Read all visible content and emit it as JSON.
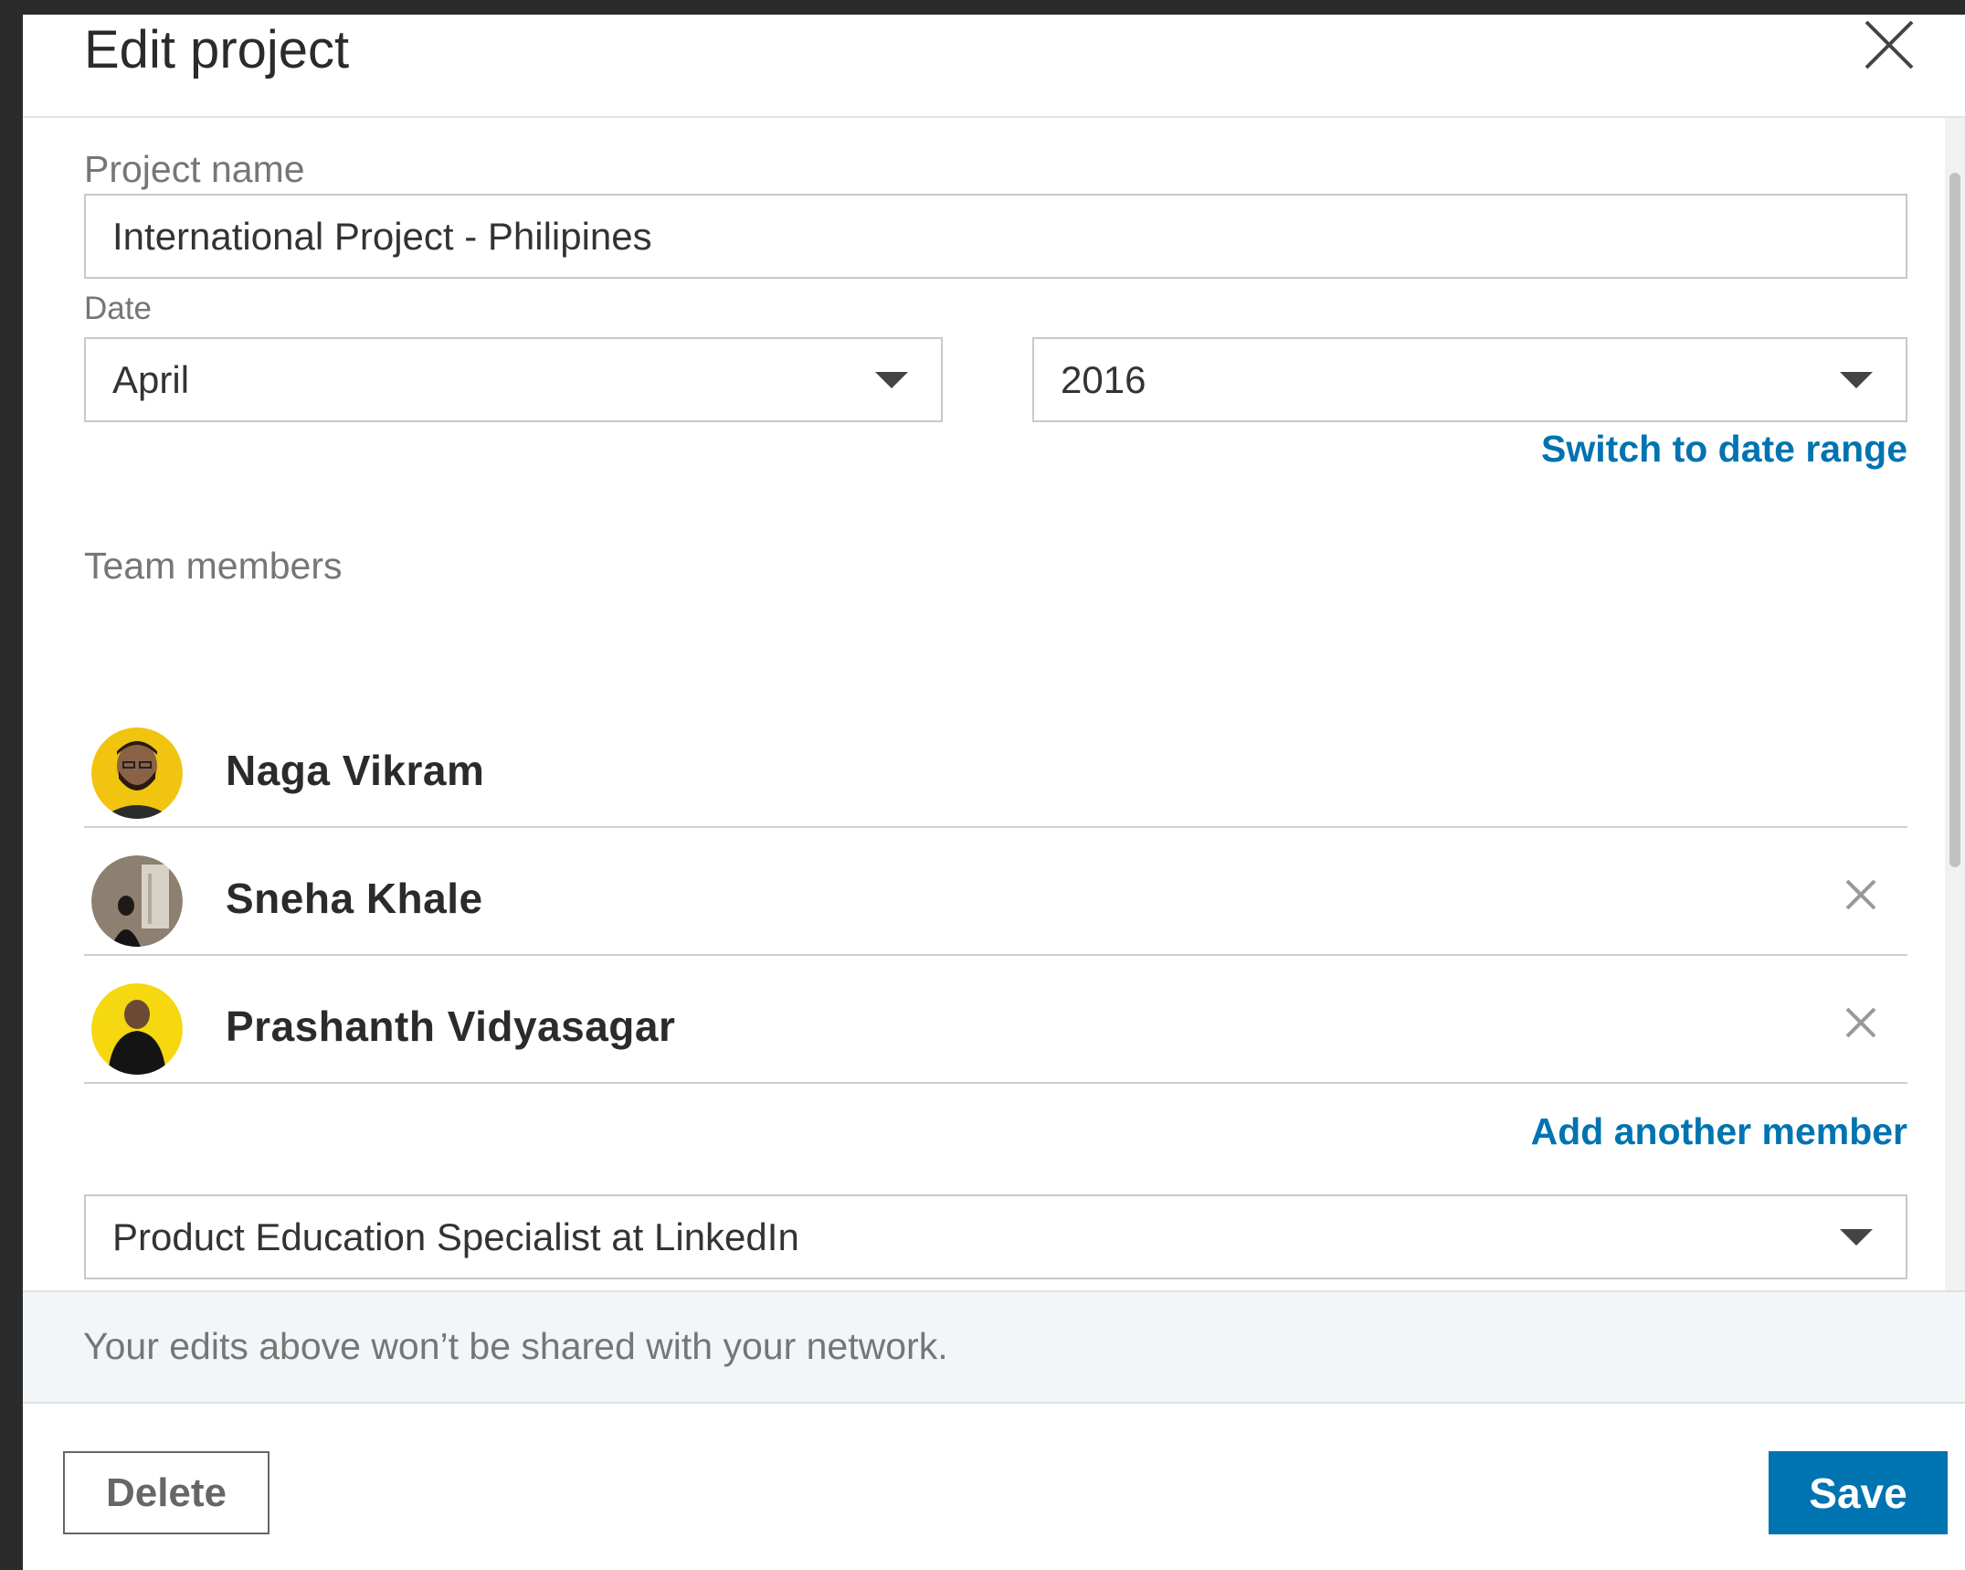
{
  "dialog": {
    "title": "Edit project"
  },
  "form": {
    "project_name_label": "Project name",
    "project_name_value": "International Project - Philipines",
    "date_label": "Date",
    "month_value": "April",
    "year_value": "2016",
    "switch_date_range_label": "Switch to date range",
    "team_members_label": "Team members",
    "members": [
      {
        "name": "Naga Vikram",
        "removable": false
      },
      {
        "name": "Sneha Khale",
        "removable": true
      },
      {
        "name": "Prashanth Vidyasagar",
        "removable": true
      }
    ],
    "add_member_label": "Add another member",
    "associated_position_value": "Product Education Specialist at LinkedIn"
  },
  "footer": {
    "note": "Your edits above won’t be shared with your network.",
    "delete_label": "Delete",
    "save_label": "Save"
  },
  "colors": {
    "accent": "#0073b1",
    "note_background": "#f3f6f8"
  },
  "icons": {
    "close": "close-icon",
    "remove": "remove-x-icon",
    "dropdown": "chevron-down-icon"
  }
}
